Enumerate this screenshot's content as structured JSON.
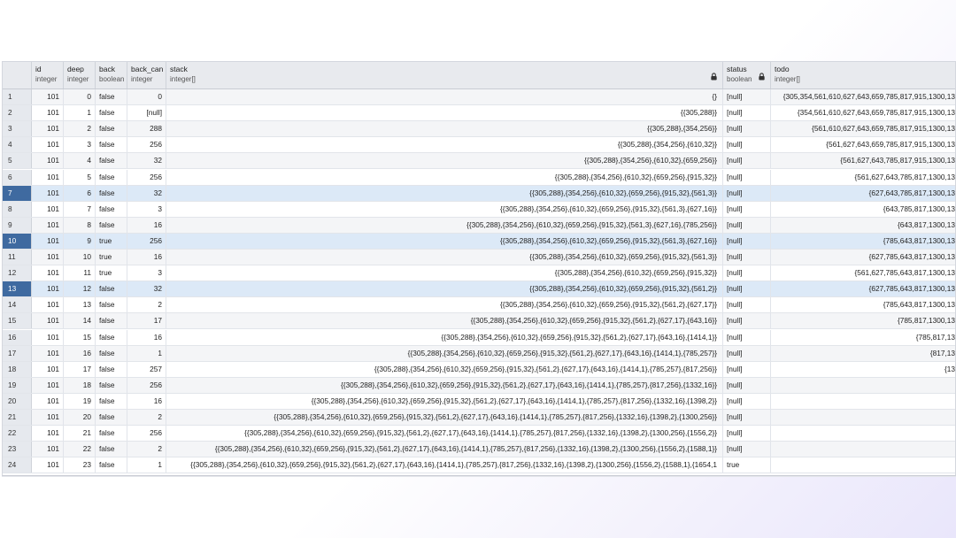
{
  "columns": [
    {
      "name": "",
      "type": ""
    },
    {
      "name": "id",
      "type": "integer"
    },
    {
      "name": "deep",
      "type": "integer"
    },
    {
      "name": "back",
      "type": "boolean"
    },
    {
      "name": "back_can",
      "type": "integer"
    },
    {
      "name": "stack",
      "type": "integer[]"
    },
    {
      "name": "status",
      "type": "boolean"
    },
    {
      "name": "todo",
      "type": "integer[]"
    }
  ],
  "rows": [
    {
      "n": "1",
      "id": "101",
      "deep": "0",
      "back": "false",
      "back_can": "0",
      "stack": "{}",
      "status": "[null]",
      "todo": "{305,354,561,610,627,643,659,785,817,915,1300,13"
    },
    {
      "n": "2",
      "id": "101",
      "deep": "1",
      "back": "false",
      "back_can": "[null]",
      "stack": "{{305,288}}",
      "status": "[null]",
      "todo": "{354,561,610,627,643,659,785,817,915,1300,13"
    },
    {
      "n": "3",
      "id": "101",
      "deep": "2",
      "back": "false",
      "back_can": "288",
      "stack": "{{305,288},{354,256}}",
      "status": "[null]",
      "todo": "{561,610,627,643,659,785,817,915,1300,13"
    },
    {
      "n": "4",
      "id": "101",
      "deep": "3",
      "back": "false",
      "back_can": "256",
      "stack": "{{305,288},{354,256},{610,32}}",
      "status": "[null]",
      "todo": "{561,627,643,659,785,817,915,1300,13"
    },
    {
      "n": "5",
      "id": "101",
      "deep": "4",
      "back": "false",
      "back_can": "32",
      "stack": "{{305,288},{354,256},{610,32},{659,256}}",
      "status": "[null]",
      "todo": "{561,627,643,785,817,915,1300,13"
    },
    {
      "n": "6",
      "id": "101",
      "deep": "5",
      "back": "false",
      "back_can": "256",
      "stack": "{{305,288},{354,256},{610,32},{659,256},{915,32}}",
      "status": "[null]",
      "todo": "{561,627,643,785,817,1300,13"
    },
    {
      "n": "7",
      "id": "101",
      "deep": "6",
      "back": "false",
      "back_can": "32",
      "stack": "{{305,288},{354,256},{610,32},{659,256},{915,32},{561,3}}",
      "status": "[null]",
      "todo": "{627,643,785,817,1300,13"
    },
    {
      "n": "8",
      "id": "101",
      "deep": "7",
      "back": "false",
      "back_can": "3",
      "stack": "{{305,288},{354,256},{610,32},{659,256},{915,32},{561,3},{627,16}}",
      "status": "[null]",
      "todo": "{643,785,817,1300,13"
    },
    {
      "n": "9",
      "id": "101",
      "deep": "8",
      "back": "false",
      "back_can": "16",
      "stack": "{{305,288},{354,256},{610,32},{659,256},{915,32},{561,3},{627,16},{785,256}}",
      "status": "[null]",
      "todo": "{643,817,1300,13"
    },
    {
      "n": "10",
      "id": "101",
      "deep": "9",
      "back": "true",
      "back_can": "256",
      "stack": "{{305,288},{354,256},{610,32},{659,256},{915,32},{561,3},{627,16}}",
      "status": "[null]",
      "todo": "{785,643,817,1300,13"
    },
    {
      "n": "11",
      "id": "101",
      "deep": "10",
      "back": "true",
      "back_can": "16",
      "stack": "{{305,288},{354,256},{610,32},{659,256},{915,32},{561,3}}",
      "status": "[null]",
      "todo": "{627,785,643,817,1300,13"
    },
    {
      "n": "12",
      "id": "101",
      "deep": "11",
      "back": "true",
      "back_can": "3",
      "stack": "{{305,288},{354,256},{610,32},{659,256},{915,32}}",
      "status": "[null]",
      "todo": "{561,627,785,643,817,1300,13"
    },
    {
      "n": "13",
      "id": "101",
      "deep": "12",
      "back": "false",
      "back_can": "32",
      "stack": "{{305,288},{354,256},{610,32},{659,256},{915,32},{561,2}}",
      "status": "[null]",
      "todo": "{627,785,643,817,1300,13"
    },
    {
      "n": "14",
      "id": "101",
      "deep": "13",
      "back": "false",
      "back_can": "2",
      "stack": "{{305,288},{354,256},{610,32},{659,256},{915,32},{561,2},{627,17}}",
      "status": "[null]",
      "todo": "{785,643,817,1300,13"
    },
    {
      "n": "15",
      "id": "101",
      "deep": "14",
      "back": "false",
      "back_can": "17",
      "stack": "{{305,288},{354,256},{610,32},{659,256},{915,32},{561,2},{627,17},{643,16}}",
      "status": "[null]",
      "todo": "{785,817,1300,13"
    },
    {
      "n": "16",
      "id": "101",
      "deep": "15",
      "back": "false",
      "back_can": "16",
      "stack": "{{305,288},{354,256},{610,32},{659,256},{915,32},{561,2},{627,17},{643,16},{1414,1}}",
      "status": "[null]",
      "todo": "{785,817,13"
    },
    {
      "n": "17",
      "id": "101",
      "deep": "16",
      "back": "false",
      "back_can": "1",
      "stack": "{{305,288},{354,256},{610,32},{659,256},{915,32},{561,2},{627,17},{643,16},{1414,1},{785,257}}",
      "status": "[null]",
      "todo": "{817,13"
    },
    {
      "n": "18",
      "id": "101",
      "deep": "17",
      "back": "false",
      "back_can": "257",
      "stack": "{{305,288},{354,256},{610,32},{659,256},{915,32},{561,2},{627,17},{643,16},{1414,1},{785,257},{817,256}}",
      "status": "[null]",
      "todo": "{13"
    },
    {
      "n": "19",
      "id": "101",
      "deep": "18",
      "back": "false",
      "back_can": "256",
      "stack": "{{305,288},{354,256},{610,32},{659,256},{915,32},{561,2},{627,17},{643,16},{1414,1},{785,257},{817,256},{1332,16}}",
      "status": "[null]",
      "todo": ""
    },
    {
      "n": "20",
      "id": "101",
      "deep": "19",
      "back": "false",
      "back_can": "16",
      "stack": "{{305,288},{354,256},{610,32},{659,256},{915,32},{561,2},{627,17},{643,16},{1414,1},{785,257},{817,256},{1332,16},{1398,2}}",
      "status": "[null]",
      "todo": ""
    },
    {
      "n": "21",
      "id": "101",
      "deep": "20",
      "back": "false",
      "back_can": "2",
      "stack": "{{305,288},{354,256},{610,32},{659,256},{915,32},{561,2},{627,17},{643,16},{1414,1},{785,257},{817,256},{1332,16},{1398,2},{1300,256}}",
      "status": "[null]",
      "todo": ""
    },
    {
      "n": "22",
      "id": "101",
      "deep": "21",
      "back": "false",
      "back_can": "256",
      "stack": "{{305,288},{354,256},{610,32},{659,256},{915,32},{561,2},{627,17},{643,16},{1414,1},{785,257},{817,256},{1332,16},{1398,2},{1300,256},{1556,2}}",
      "status": "[null]",
      "todo": ""
    },
    {
      "n": "23",
      "id": "101",
      "deep": "22",
      "back": "false",
      "back_can": "2",
      "stack": "{{305,288},{354,256},{610,32},{659,256},{915,32},{561,2},{627,17},{643,16},{1414,1},{785,257},{817,256},{1332,16},{1398,2},{1300,256},{1556,2},{1588,1}}",
      "status": "[null]",
      "todo": ""
    },
    {
      "n": "24",
      "id": "101",
      "deep": "23",
      "back": "false",
      "back_can": "1",
      "stack": "{{305,288},{354,256},{610,32},{659,256},{915,32},{561,2},{627,17},{643,16},{1414,1},{785,257},{817,256},{1332,16},{1398,2},{1300,256},{1556,2},{1588,1},{1654,1",
      "status": "true",
      "todo": ""
    }
  ],
  "selected_rows": [
    "7",
    "10",
    "13"
  ],
  "icons": {
    "stack_lock": "lock-icon",
    "status_lock": "lock-icon"
  },
  "colors": {
    "selected_row_number": "#3f6aa0",
    "selected_row": "#dce9f7",
    "header": "#e8eaee"
  }
}
